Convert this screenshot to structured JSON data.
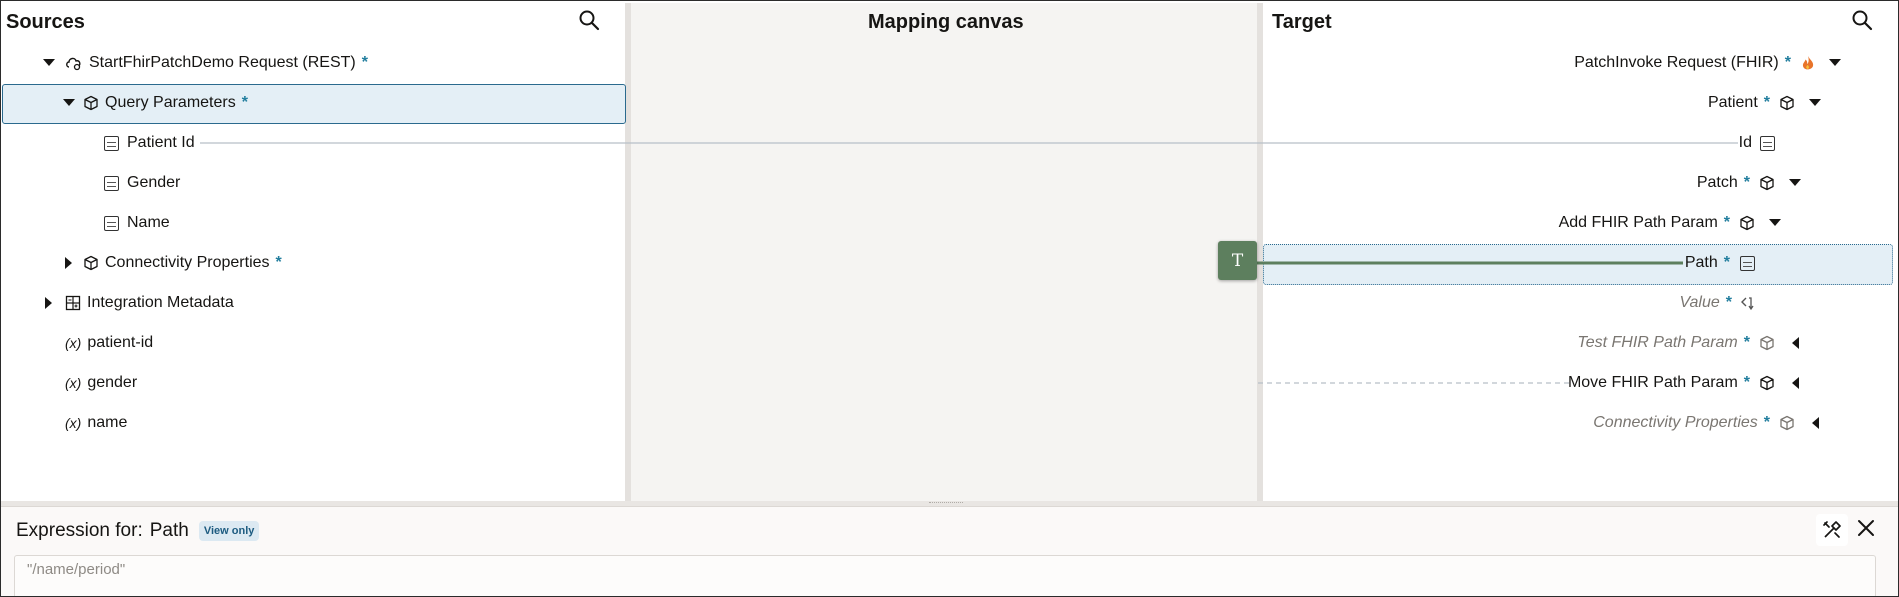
{
  "panes": {
    "sources_title": "Sources",
    "canvas_title": "Mapping canvas",
    "target_title": "Target"
  },
  "sources": {
    "request": "StartFhirPatchDemo Request (REST)",
    "query_params": "Query Parameters",
    "patient_id": "Patient Id",
    "gender": "Gender",
    "name": "Name",
    "connectivity": "Connectivity Properties",
    "integration_metadata": "Integration Metadata",
    "var_prefix": "(x)",
    "var_patient_id": "patient-id",
    "var_gender": "gender",
    "var_name": "name"
  },
  "target": {
    "request": "PatchInvoke Request (FHIR)",
    "patient": "Patient",
    "id": "Id",
    "patch": "Patch",
    "add_param": "Add FHIR Path Param",
    "path": "Path",
    "value": "Value",
    "test_param": "Test FHIR Path Param",
    "move_param": "Move FHIR Path Param",
    "connectivity": "Connectivity Properties"
  },
  "mapping": {
    "function_glyph": "T"
  },
  "required_marker": "*",
  "expression": {
    "label": "Expression for:",
    "field": "Path",
    "badge": "View only",
    "value": "\"/name/period\""
  },
  "colors": {
    "accent": "#227e9e",
    "selection_bg": "#e4eff6",
    "selection_border": "#2a6a8e",
    "function_node": "#5d7f5e",
    "mapping_line": "#b6bfc8"
  }
}
